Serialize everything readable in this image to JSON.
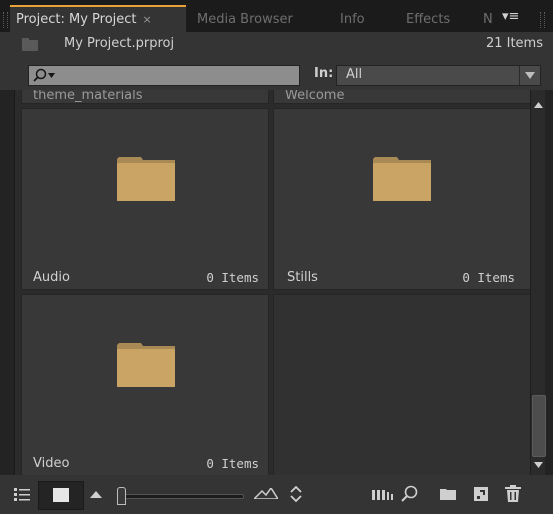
{
  "tabs": [
    {
      "label": "Project: My Project",
      "close": "×"
    },
    {
      "label": "Media Browser"
    },
    {
      "label": "Info"
    },
    {
      "label": "Effects"
    },
    {
      "label": "N"
    }
  ],
  "project": {
    "file_name": "My Project.prproj",
    "item_count": "21 Items"
  },
  "search": {
    "placeholder": ""
  },
  "in_filter": {
    "label": "In:",
    "value": "All"
  },
  "top_row_partial": [
    "theme_materials",
    "Welcome"
  ],
  "bins": [
    {
      "name": "Audio",
      "count": "0 Items"
    },
    {
      "name": "Stills",
      "count": "0 Items"
    },
    {
      "name": "Video",
      "count": "0 Items"
    }
  ],
  "colors": {
    "accent": "#e8a23a",
    "folder": "#c9a465"
  },
  "icons": {
    "panel_menu": "panel-menu-icon",
    "list_view": "list-view-icon",
    "icon_view": "icon-view-icon",
    "zoom_out": "zoom-out-icon",
    "zoom_in": "zoom-in-icon",
    "sort": "sort-icon",
    "automate": "automate-to-sequence-icon",
    "find": "find-icon",
    "new_bin": "new-bin-icon",
    "new_item": "new-item-icon",
    "delete": "trash-icon"
  }
}
